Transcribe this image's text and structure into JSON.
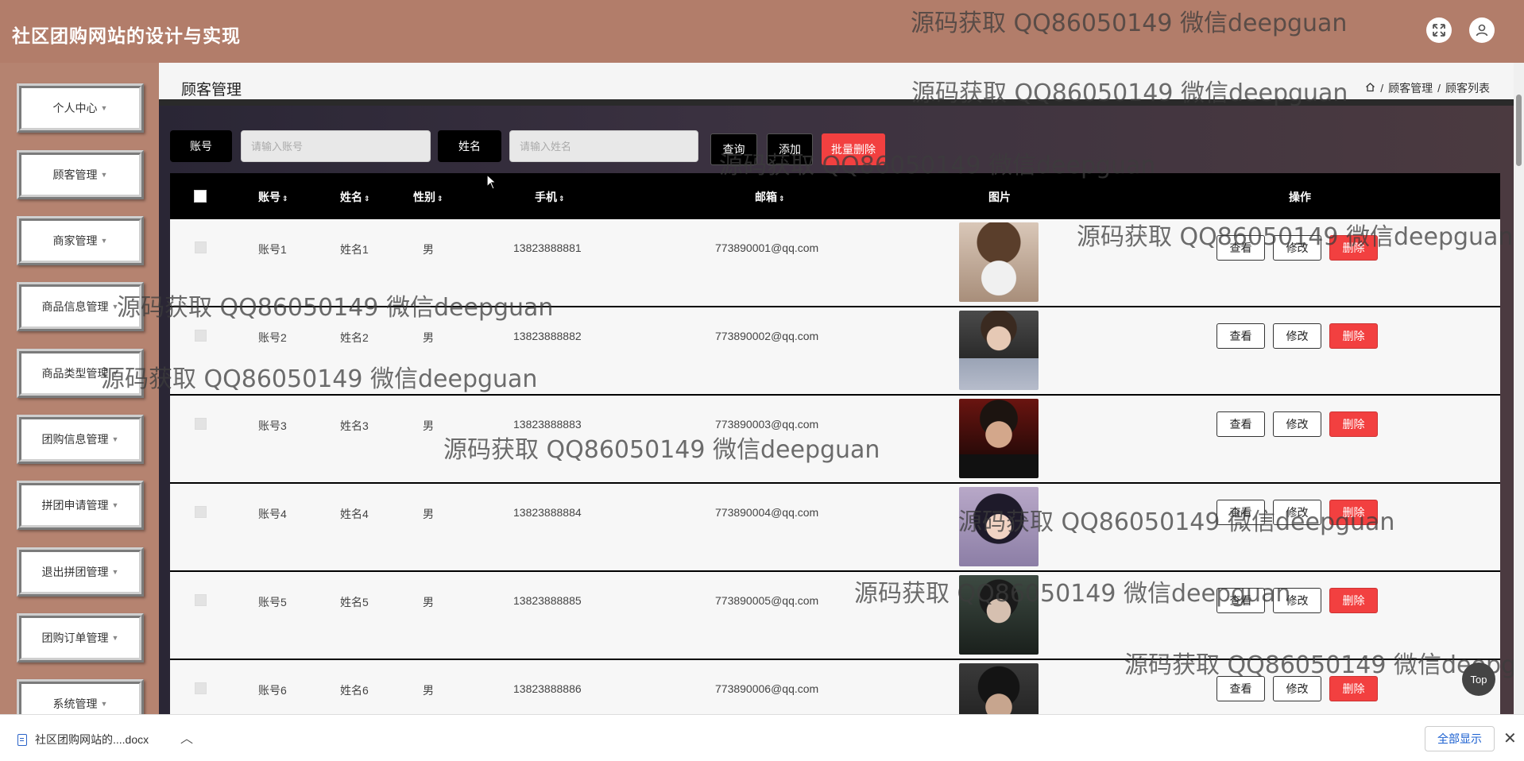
{
  "header": {
    "app_title": "社区团购网站的设计与实现",
    "fullscreen_icon": "⤢",
    "user_icon": "user-icon"
  },
  "sidebar": {
    "items": [
      {
        "label": "个人中心"
      },
      {
        "label": "顾客管理"
      },
      {
        "label": "商家管理"
      },
      {
        "label": "商品信息管理"
      },
      {
        "label": "商品类型管理"
      },
      {
        "label": "团购信息管理"
      },
      {
        "label": "拼团申请管理"
      },
      {
        "label": "退出拼团管理"
      },
      {
        "label": "团购订单管理"
      },
      {
        "label": "系统管理"
      }
    ]
  },
  "page": {
    "title": "顾客管理",
    "breadcrumb": [
      "顾客管理",
      "顾客列表"
    ]
  },
  "search": {
    "account_label": "账号",
    "account_placeholder": "请输入账号",
    "name_label": "姓名",
    "name_placeholder": "请输入姓名",
    "query_btn": "查询",
    "add_btn": "添加",
    "batch_delete_btn": "批量删除"
  },
  "table": {
    "headers": {
      "account": "账号",
      "name": "姓名",
      "gender": "性别",
      "phone": "手机",
      "email": "邮箱",
      "photo": "图片",
      "actions": "操作"
    },
    "action_labels": {
      "view": "查看",
      "edit": "修改",
      "delete": "删除"
    },
    "rows": [
      {
        "account": "账号1",
        "name": "姓名1",
        "gender": "男",
        "phone": "13823888881",
        "email": "773890001@qq.com"
      },
      {
        "account": "账号2",
        "name": "姓名2",
        "gender": "男",
        "phone": "13823888882",
        "email": "773890002@qq.com"
      },
      {
        "account": "账号3",
        "name": "姓名3",
        "gender": "男",
        "phone": "13823888883",
        "email": "773890003@qq.com"
      },
      {
        "account": "账号4",
        "name": "姓名4",
        "gender": "男",
        "phone": "13823888884",
        "email": "773890004@qq.com"
      },
      {
        "account": "账号5",
        "name": "姓名5",
        "gender": "男",
        "phone": "13823888885",
        "email": "773890005@qq.com"
      },
      {
        "account": "账号6",
        "name": "姓名6",
        "gender": "男",
        "phone": "13823888886",
        "email": "773890006@qq.com"
      }
    ]
  },
  "watermark": "源码获取 QQ86050149 微信deepguan",
  "top_button": "Top",
  "download_bar": {
    "filename": "社区团购网站的....docx",
    "show_all": "全部显示"
  },
  "colors": {
    "header_bg": "#b27d6a",
    "delete_red": "#f24040",
    "table_header": "#000000"
  }
}
